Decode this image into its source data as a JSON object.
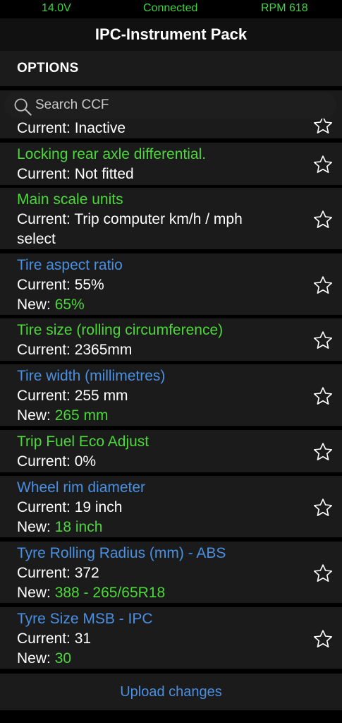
{
  "status": {
    "voltage": "14.0V",
    "connection": "Connected",
    "rpm": "RPM 618"
  },
  "app": {
    "title": "IPC-Instrument Pack"
  },
  "section": {
    "title": "OPTIONS"
  },
  "search": {
    "placeholder": "Search CCF",
    "value": ""
  },
  "rows": [
    {
      "title": "",
      "current": "Current: Inactive",
      "new_label": "",
      "new_value": "",
      "title_color": "white"
    },
    {
      "title": "Locking rear axle differential.",
      "current": "Current: Not fitted",
      "new_label": "",
      "new_value": "",
      "title_color": "green"
    },
    {
      "title": "Main scale units",
      "current": "Current: Trip computer km/h / mph",
      "current2": "select",
      "new_label": "",
      "new_value": "",
      "title_color": "green"
    },
    {
      "title": "Tire aspect ratio",
      "current": "Current: 55%",
      "new_label": "New: ",
      "new_value": "65%",
      "title_color": "blue"
    },
    {
      "title": "Tire size (rolling circumference)",
      "current": "Current: 2365mm",
      "new_label": "",
      "new_value": "",
      "title_color": "green"
    },
    {
      "title": "Tire width (millimetres)",
      "current": "Current: 255 mm",
      "new_label": "New: ",
      "new_value": "265 mm",
      "title_color": "blue"
    },
    {
      "title": "Trip Fuel Eco Adjust",
      "current": "Current: 0%",
      "new_label": "",
      "new_value": "",
      "title_color": "green"
    },
    {
      "title": "Wheel rim diameter",
      "current": "Current: 19 inch",
      "new_label": "New: ",
      "new_value": "18 inch",
      "title_color": "blue"
    },
    {
      "title": "Tyre Rolling Radius (mm) - ABS",
      "current": "Current: 372",
      "new_label": "New: ",
      "new_value": "388 - 265/65R18",
      "title_color": "blue"
    },
    {
      "title": "Tyre Size MSB - IPC",
      "current": "Current: 31",
      "new_label": "New: ",
      "new_value": "30",
      "title_color": "blue"
    }
  ],
  "footer": {
    "upload_label": "Upload changes"
  },
  "colors": {
    "accent_blue": "#4a90e2",
    "accent_green": "#4cd83a",
    "status_green": "#3fd43f",
    "row_bg": "#1b1b1b"
  },
  "icons": {
    "search": "search-icon",
    "star": "star-icon"
  }
}
